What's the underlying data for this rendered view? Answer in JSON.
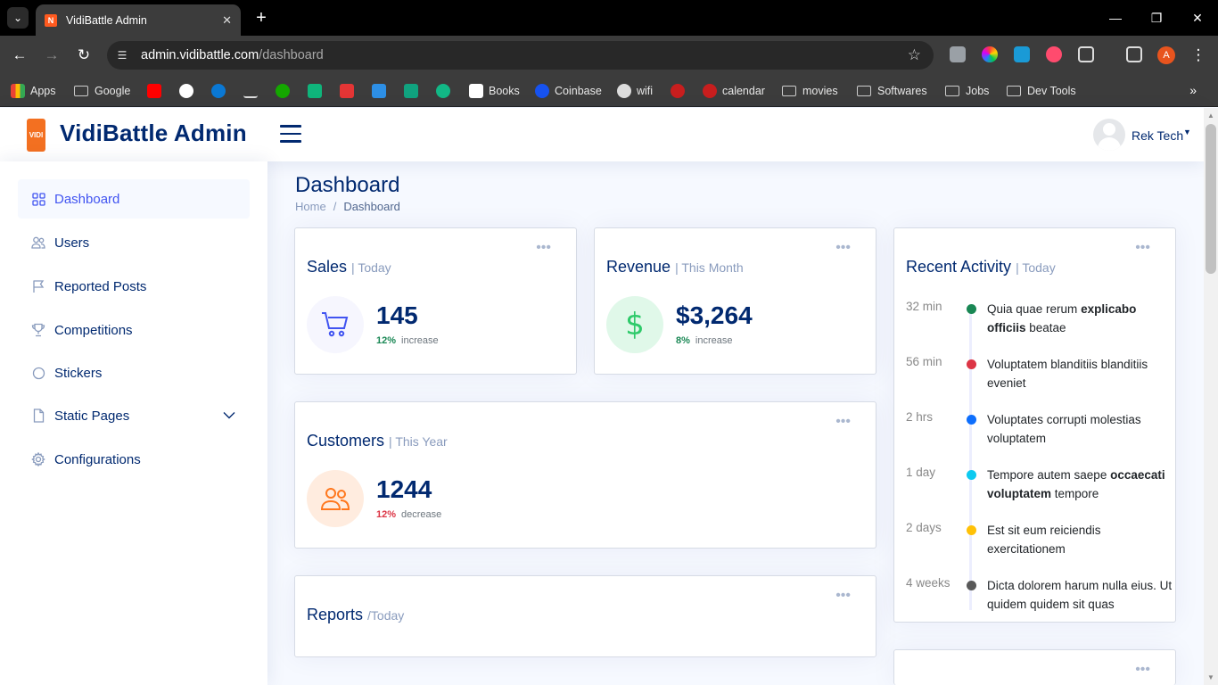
{
  "browser": {
    "tab_title": "VidiBattle Admin",
    "url_host": "admin.vidibattle.com",
    "url_path": "/dashboard",
    "profile_initial": "A",
    "bookmarks": [
      "Apps",
      "Google",
      "Books",
      "Coinbase",
      "wifi",
      "calendar",
      "movies",
      "Softwares",
      "Jobs",
      "Dev Tools"
    ]
  },
  "header": {
    "brand": "VidiBattle Admin",
    "logo_text": "VIDI",
    "user_name": "Rek Tech"
  },
  "sidebar": {
    "items": [
      {
        "label": "Dashboard",
        "icon": "grid-icon"
      },
      {
        "label": "Users",
        "icon": "people-icon"
      },
      {
        "label": "Reported Posts",
        "icon": "flag-icon"
      },
      {
        "label": "Competitions",
        "icon": "trophy-icon"
      },
      {
        "label": "Stickers",
        "icon": "circle-icon"
      },
      {
        "label": "Static Pages",
        "icon": "file-icon"
      },
      {
        "label": "Configurations",
        "icon": "gear-icon"
      }
    ]
  },
  "page": {
    "title": "Dashboard",
    "breadcrumb": [
      "Home",
      "/",
      "Dashboard"
    ]
  },
  "cards": {
    "sales": {
      "title": "Sales",
      "period": "| Today",
      "value": "145",
      "pct": "12%",
      "change": "increase",
      "icon": "cart-icon"
    },
    "revenue": {
      "title": "Revenue",
      "period": "| This Month",
      "value": "$3,264",
      "pct": "8%",
      "change": "increase",
      "icon": "dollar-icon"
    },
    "customers": {
      "title": "Customers",
      "period": "| This Year",
      "value": "1244",
      "pct": "12%",
      "change": "decrease",
      "icon": "people-icon"
    },
    "reports": {
      "title": "Reports",
      "period": "/Today"
    }
  },
  "activity": {
    "title": "Recent Activity",
    "period": "| Today",
    "items": [
      {
        "time": "32 min",
        "color": "#198754",
        "pre": "Quia quae rerum ",
        "bold": "explicabo officiis",
        "post": " beatae"
      },
      {
        "time": "56 min",
        "color": "#dc3545",
        "pre": "Voluptatem blanditiis blanditiis eveniet",
        "bold": "",
        "post": ""
      },
      {
        "time": "2 hrs",
        "color": "#0d6efd",
        "pre": "Voluptates corrupti molestias voluptatem",
        "bold": "",
        "post": ""
      },
      {
        "time": "1 day",
        "color": "#0dcaf0",
        "pre": "Tempore autem saepe ",
        "bold": "occaecati voluptatem",
        "post": " tempore"
      },
      {
        "time": "2 days",
        "color": "#ffc107",
        "pre": "Est sit eum reiciendis exercitationem",
        "bold": "",
        "post": ""
      },
      {
        "time": "4 weeks",
        "color": "#595959",
        "pre": "Dicta dolorem harum nulla eius. Ut quidem quidem sit quas",
        "bold": "",
        "post": ""
      }
    ]
  }
}
